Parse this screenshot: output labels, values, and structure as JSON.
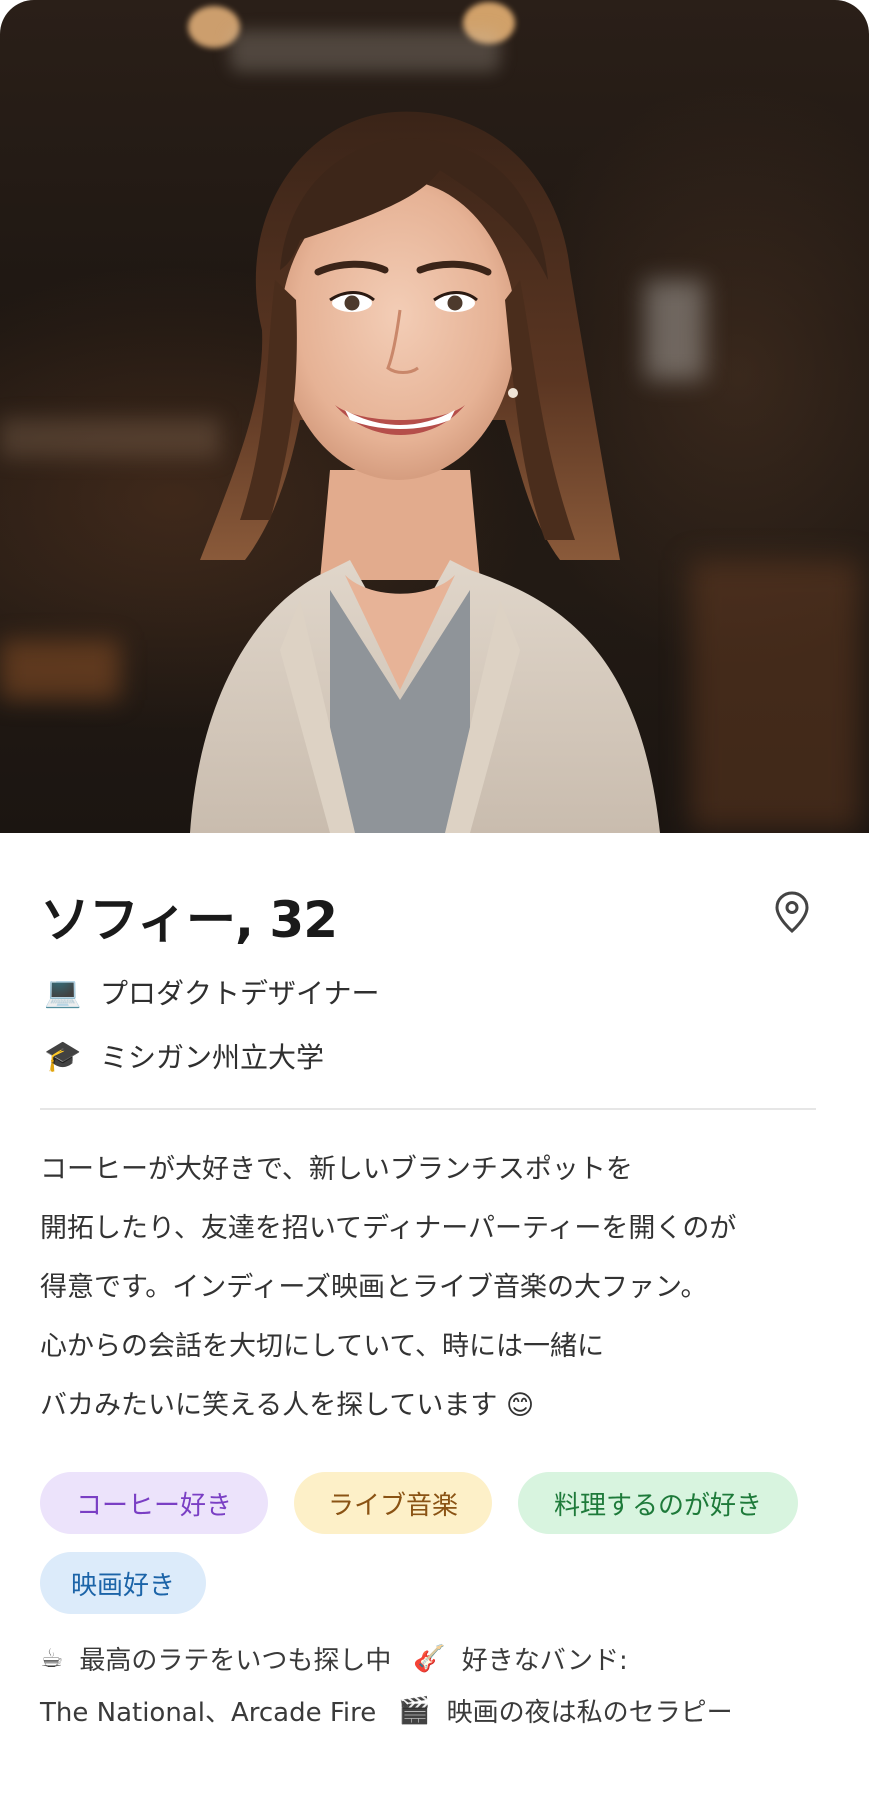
{
  "profile": {
    "name_age": "ソフィー, 32",
    "job": {
      "icon": "laptop-icon",
      "emoji": "💻",
      "text": "プロダクトデザイナー"
    },
    "education": {
      "icon": "graduation-cap-icon",
      "emoji": "🎓",
      "text": "ミシガン州立大学"
    },
    "location_icon": "location-pin-icon"
  },
  "bio": {
    "lines": [
      "コーヒーが大好きで、新しいブランチスポットを",
      "開拓したり、友達を招いてディナーパーティーを開くのが",
      "得意です。インディーズ映画とライブ音楽の大ファン。",
      "心からの会話を大切にしていて、時には一緒に",
      "バカみたいに笑える人を探しています 😊"
    ]
  },
  "tags": [
    {
      "label": "コーヒー好き",
      "color": "#ece3fb"
    },
    {
      "label": "ライブ音楽",
      "color": "#fdf0c8"
    },
    {
      "label": "料理するのが好き",
      "color": "#d8f4df"
    },
    {
      "label": "映画好き",
      "color": "#dcebfa"
    }
  ],
  "facts": {
    "line1": {
      "a_emoji": "☕",
      "a_text": "最高のラテをいつも探し中",
      "b_emoji": "🎸",
      "b_text": "好きなバンド:"
    },
    "line2": {
      "a_text": "The National、Arcade Fire",
      "b_emoji": "🎬",
      "b_text": "映画の夜は私のセラピー"
    }
  }
}
